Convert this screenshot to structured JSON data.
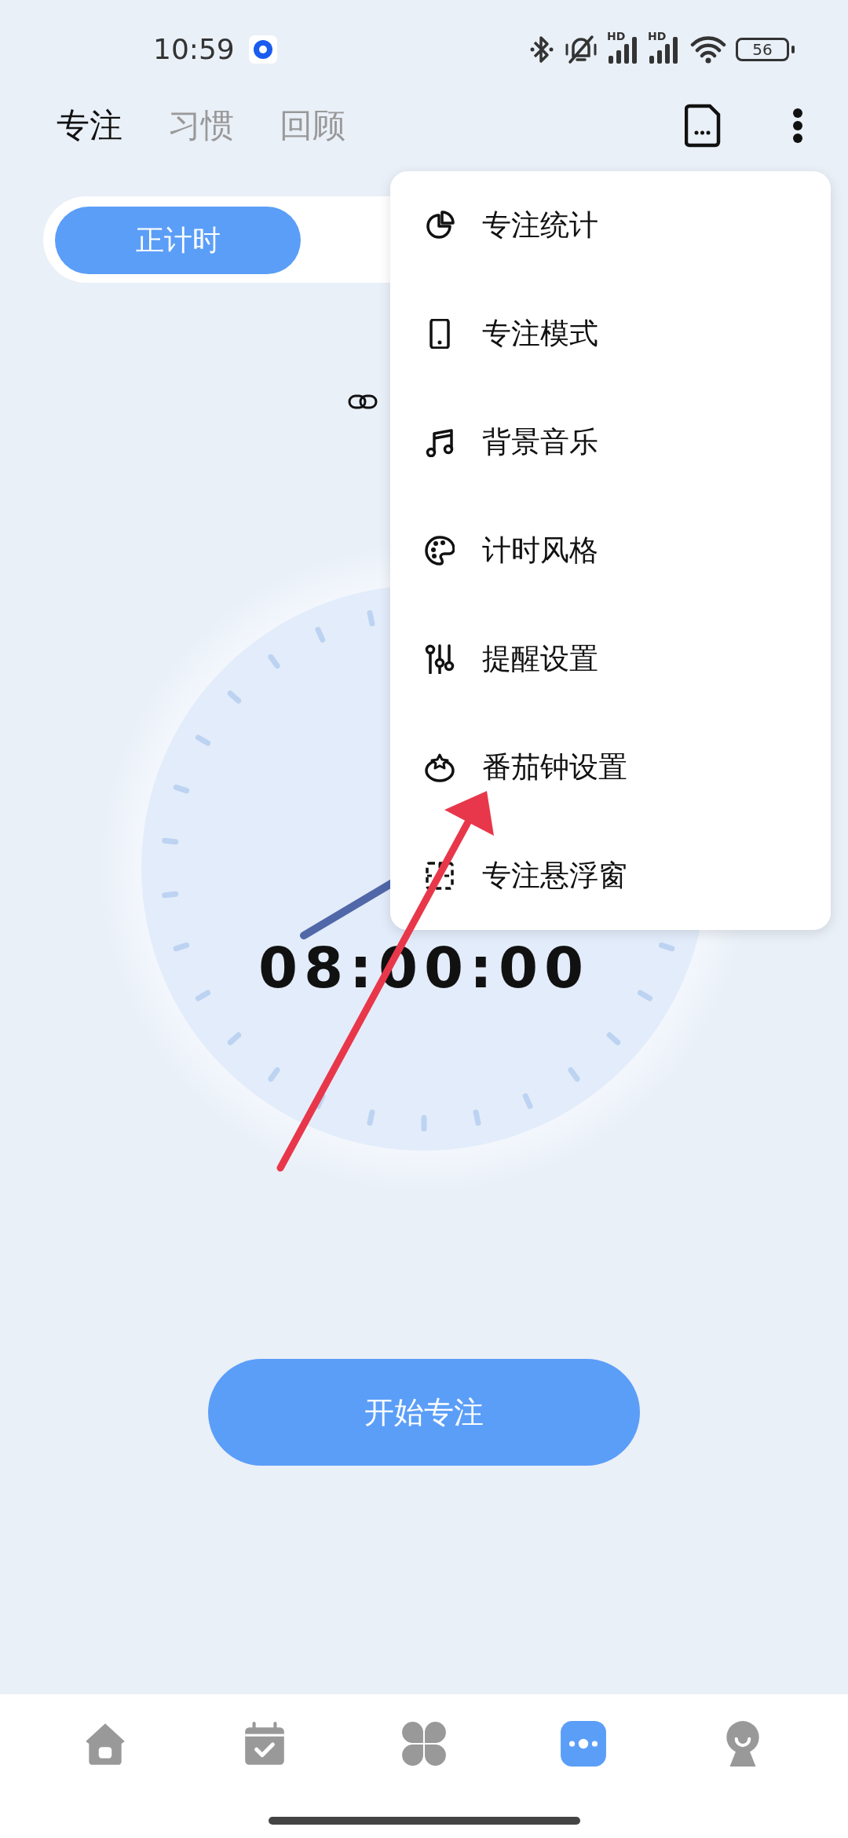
{
  "status_bar": {
    "time": "10:59",
    "signals": [
      {
        "label": "HD"
      },
      {
        "label": "HD"
      }
    ],
    "battery": "56"
  },
  "header": {
    "tabs": [
      {
        "label": "专注",
        "selected": true
      },
      {
        "label": "习惯",
        "selected": false
      },
      {
        "label": "回顾",
        "selected": false
      }
    ]
  },
  "mode_switch": {
    "segments": [
      {
        "label": "正计时",
        "selected": true
      }
    ]
  },
  "clock": {
    "time": "08:00:00"
  },
  "start_button": {
    "label": "开始专注"
  },
  "menu": {
    "items": [
      {
        "label": "专注统计"
      },
      {
        "label": "专注模式"
      },
      {
        "label": "背景音乐"
      },
      {
        "label": "计时风格"
      },
      {
        "label": "提醒设置"
      },
      {
        "label": "番茄钟设置"
      },
      {
        "label": "专注悬浮窗"
      }
    ]
  },
  "bottom_nav": [
    {
      "selected": false
    },
    {
      "selected": false
    },
    {
      "selected": false
    },
    {
      "selected": true
    },
    {
      "selected": false
    }
  ]
}
